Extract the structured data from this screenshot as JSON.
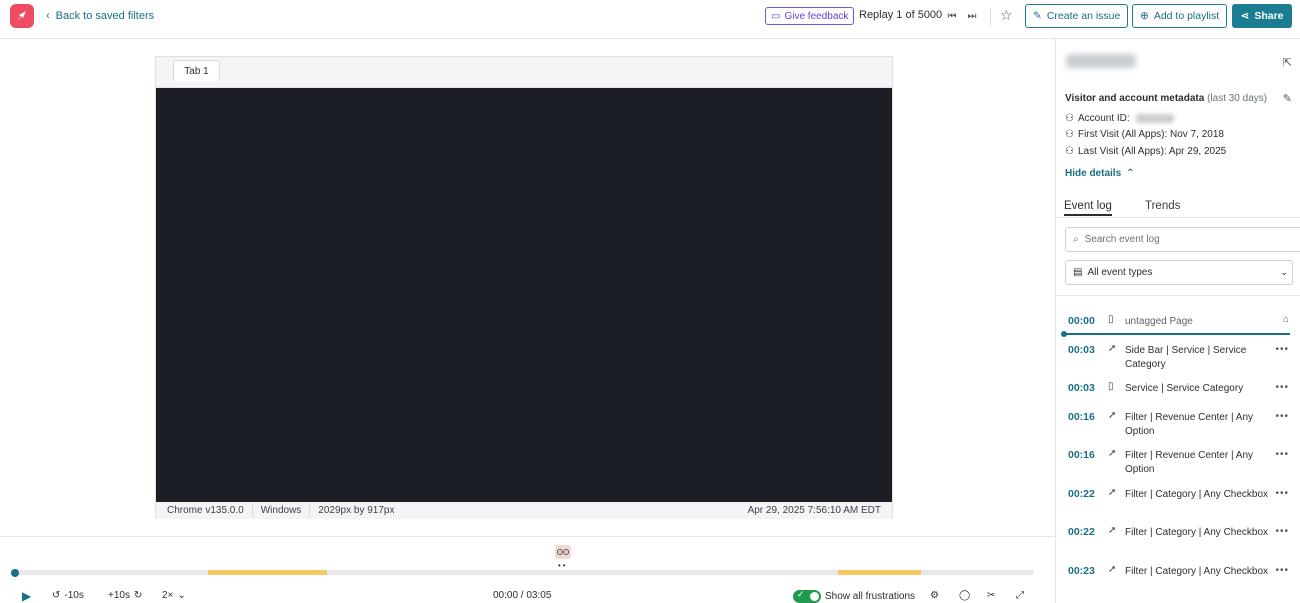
{
  "header": {
    "back_label": "Back to saved filters",
    "feedback_label": "Give feedback",
    "replay_count": "Replay 1 of 5000",
    "create_issue_label": "Create an issue",
    "add_playlist_label": "Add to playlist",
    "share_label": "Share"
  },
  "player": {
    "tab_label": "Tab 1",
    "browser": "Chrome v135.0.0",
    "os": "Windows",
    "resolution": "2029px by 917px",
    "timestamp": "Apr 29, 2025 7:56:10 AM EDT",
    "progress": 0.0
  },
  "controls": {
    "rewind_label": "-10s",
    "forward_label": "+10s",
    "speed_label": "2×",
    "time_display": "00:00 / 03:05",
    "show_frustrations_label": "Show all frustrations",
    "show_frustrations_on": true
  },
  "timeline": {
    "frustration_segments": [
      {
        "start": 0.19,
        "end": 0.307
      },
      {
        "start": 0.808,
        "end": 0.889
      }
    ]
  },
  "sidebar": {
    "metadata_title": "Visitor and account metadata",
    "metadata_range": "(last 30 days)",
    "account_id_label": "Account ID:",
    "first_visit": "First Visit (All Apps): Nov 7, 2018",
    "last_visit": "Last Visit (All Apps): Apr 29, 2025",
    "hide_details_label": "Hide details",
    "tabs": [
      "Event log",
      "Trends"
    ],
    "search_placeholder": "Search event log",
    "filter_value": "All event types",
    "events": [
      {
        "time": "00:00",
        "icon": "page-icon",
        "text": "untagged Page"
      },
      {
        "time": "00:03",
        "icon": "cursor-icon",
        "text": "Side Bar | Service | Service Category"
      },
      {
        "time": "00:03",
        "icon": "page-icon",
        "text": "Service | Service Category"
      },
      {
        "time": "00:16",
        "icon": "cursor-icon",
        "text": "Filter | Revenue Center | Any Option"
      },
      {
        "time": "00:16",
        "icon": "cursor-icon",
        "text": "Filter | Revenue Center | Any Option"
      },
      {
        "time": "00:22",
        "icon": "cursor-icon",
        "text": "Filter | Category | Any Checkbox"
      },
      {
        "time": "00:22",
        "icon": "cursor-icon",
        "text": "Filter | Category | Any Checkbox"
      },
      {
        "time": "00:23",
        "icon": "cursor-icon",
        "text": "Filter | Category | Any Checkbox"
      }
    ]
  },
  "colors": {
    "accent": "#1a7d92",
    "frustration": "#f5c864",
    "toggle_on": "#1f9a4e",
    "logo": "#ef4c63"
  }
}
